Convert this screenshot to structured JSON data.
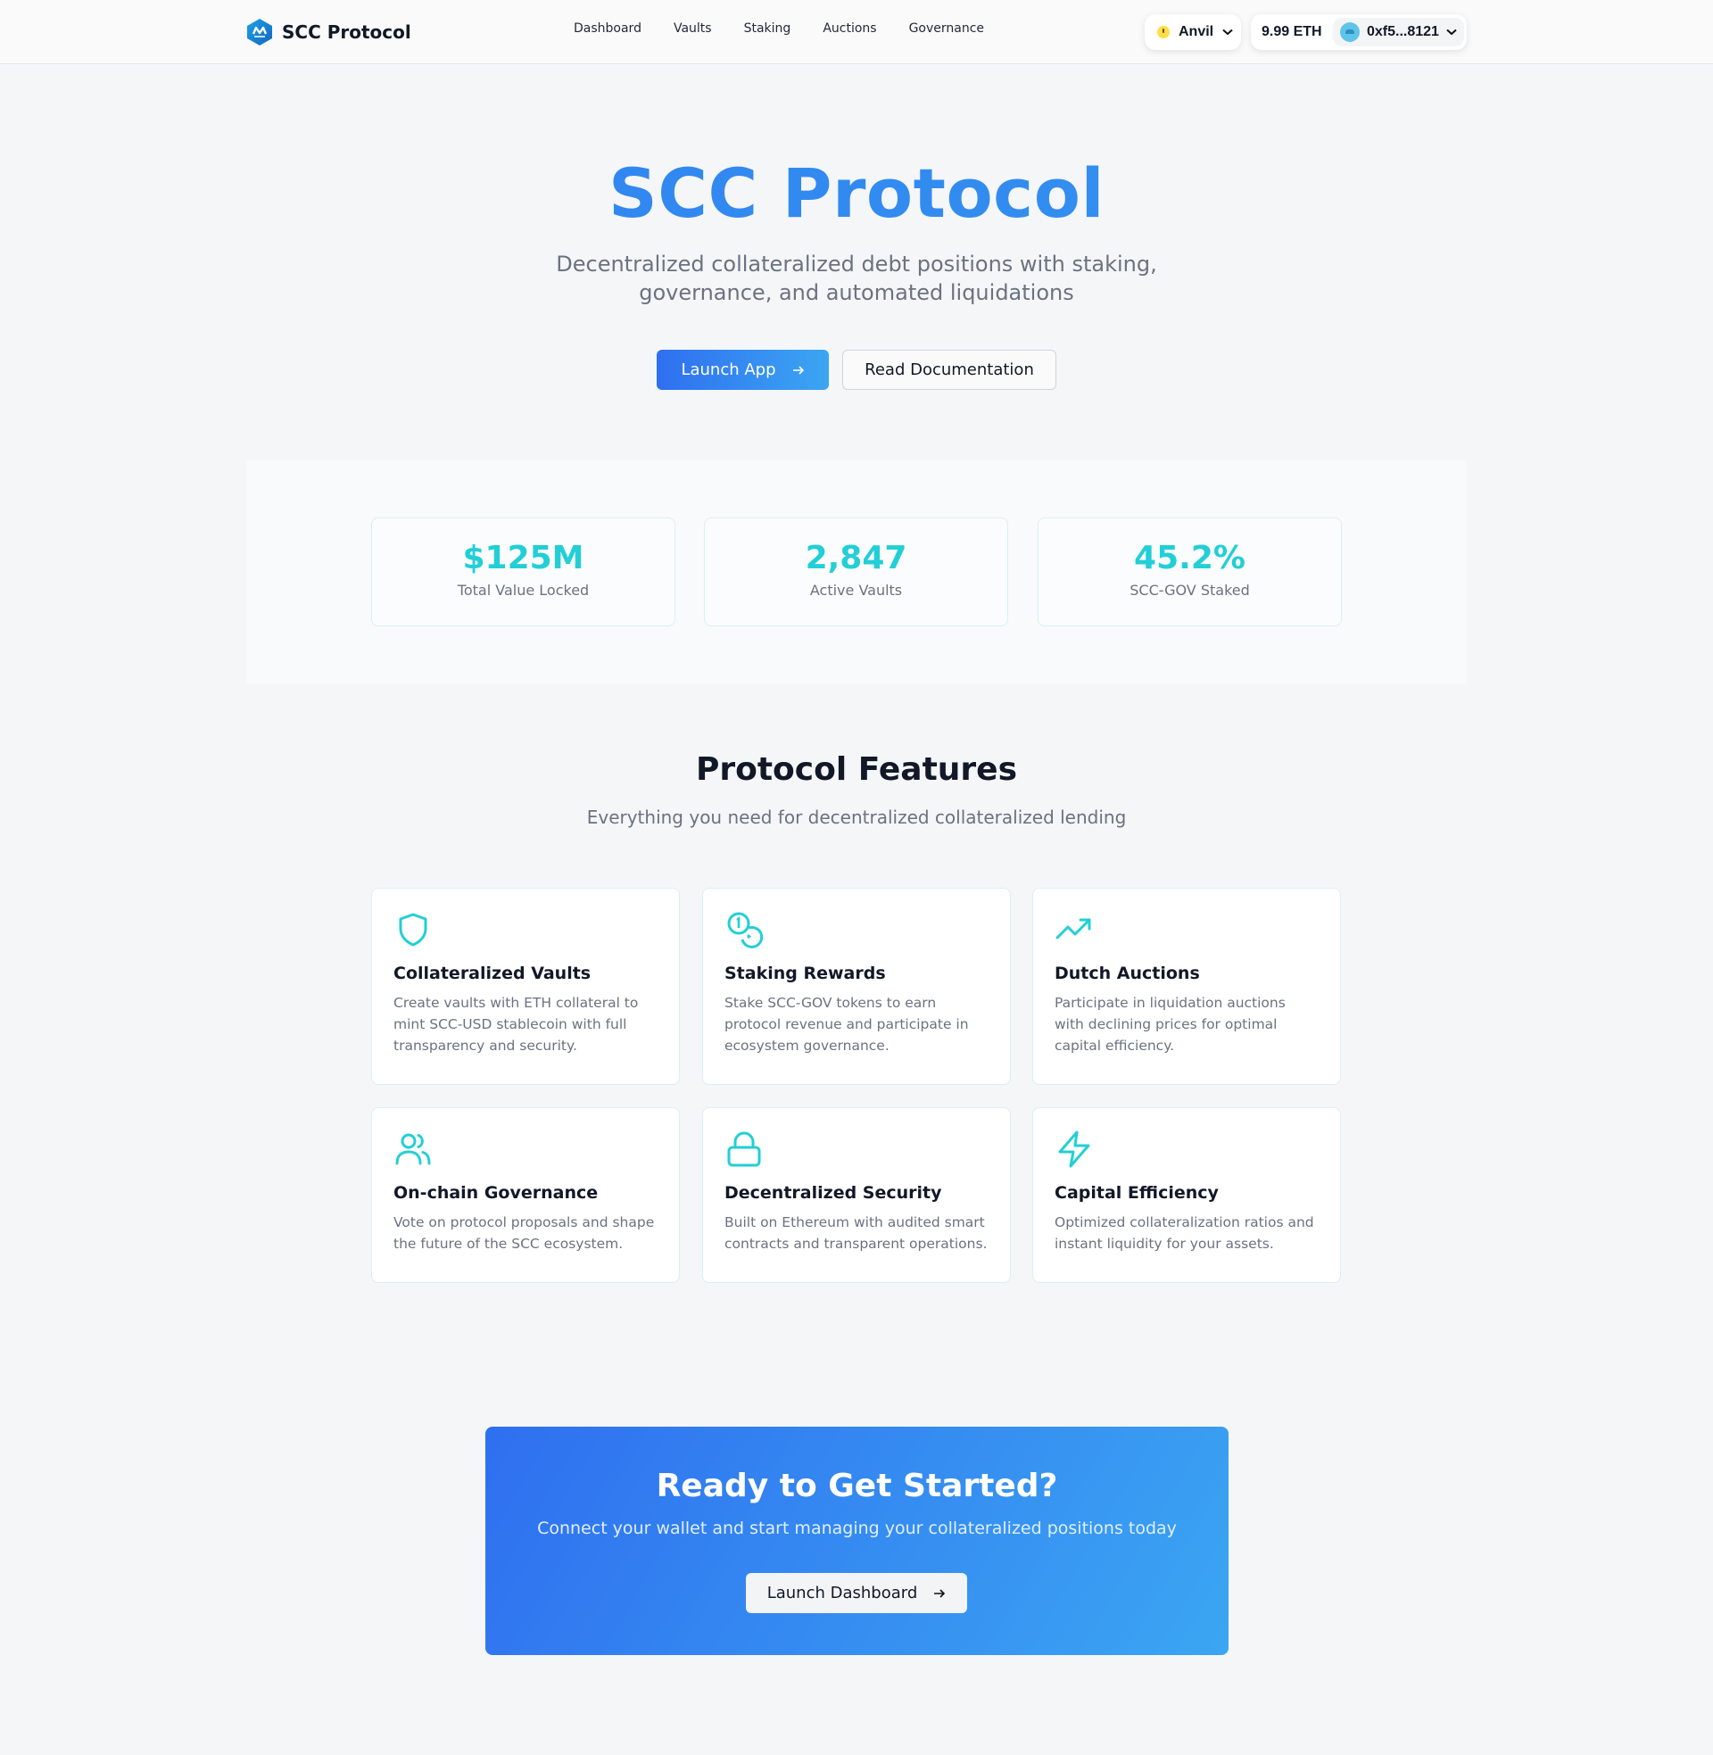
{
  "nav": {
    "brand": "SCC Protocol",
    "links": [
      "Dashboard",
      "Vaults",
      "Staking",
      "Auctions",
      "Governance"
    ],
    "network": "Anvil",
    "balance": "9.99 ETH",
    "address": "0xf5...8121"
  },
  "hero": {
    "title": "SCC Protocol",
    "subtitle": "Decentralized collateralized debt positions with staking, governance, and automated liquidations",
    "primary_button": "Launch App",
    "secondary_button": "Read Documentation"
  },
  "stats": [
    {
      "value": "$125M",
      "label": "Total Value Locked"
    },
    {
      "value": "2,847",
      "label": "Active Vaults"
    },
    {
      "value": "45.2%",
      "label": "SCC-GOV Staked"
    }
  ],
  "features": {
    "title": "Protocol Features",
    "subtitle": "Everything you need for decentralized collateralized lending",
    "items": [
      {
        "icon": "shield-icon",
        "title": "Collateralized Vaults",
        "description": "Create vaults with ETH collateral to mint SCC-USD stablecoin with full transparency and security."
      },
      {
        "icon": "coins-icon",
        "title": "Staking Rewards",
        "description": "Stake SCC-GOV tokens to earn protocol revenue and participate in ecosystem governance."
      },
      {
        "icon": "trending-up-icon",
        "title": "Dutch Auctions",
        "description": "Participate in liquidation auctions with declining prices for optimal capital efficiency."
      },
      {
        "icon": "users-icon",
        "title": "On-chain Governance",
        "description": "Vote on protocol proposals and shape the future of the SCC ecosystem."
      },
      {
        "icon": "lock-icon",
        "title": "Decentralized Security",
        "description": "Built on Ethereum with audited smart contracts and transparent operations."
      },
      {
        "icon": "zap-icon",
        "title": "Capital Efficiency",
        "description": "Optimized collateralization ratios and instant liquidity for your assets."
      }
    ]
  },
  "cta": {
    "title": "Ready to Get Started?",
    "subtitle": "Connect your wallet and start managing your collateralized positions today",
    "button": "Launch Dashboard"
  },
  "colors": {
    "accent_blue": "#2f7ff0",
    "accent_teal": "#22cfd6",
    "background": "#f5f6f8"
  }
}
